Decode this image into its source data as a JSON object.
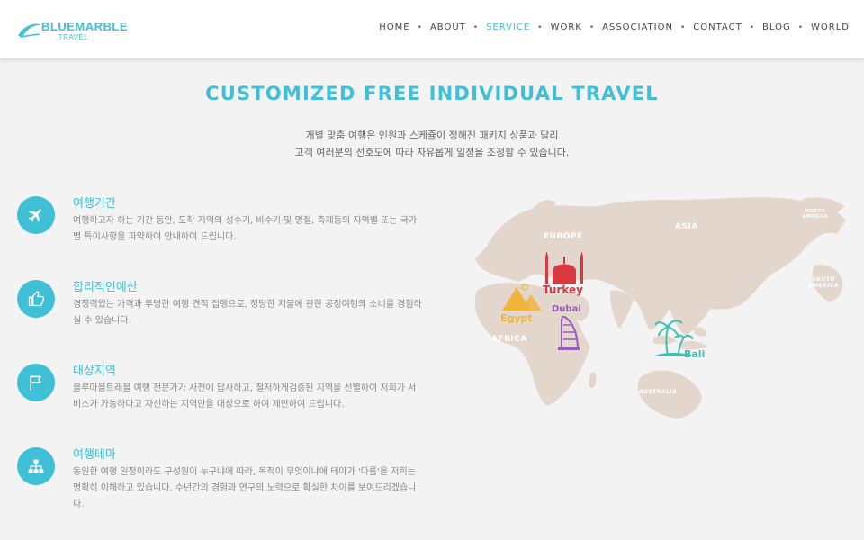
{
  "brand": {
    "name_top": "BLUEMARBLE",
    "name_bottom": ".TRAVEL"
  },
  "nav": {
    "items": [
      "HOME",
      "ABOUT",
      "SERVICE",
      "WORK",
      "ASSOCIATION",
      "CONTACT",
      "BLOG",
      "WORLD"
    ],
    "active": "SERVICE",
    "separator": "•"
  },
  "hero": {
    "title": "CUSTOMIZED FREE INDIVIDUAL TRAVEL",
    "subtitle_line1": "개별 맞춤 여행은 인원과 스케쥴이 정해진 패키지 상품과 달리",
    "subtitle_line2": "고객 여러분의 선호도에 따라 자유롭게 일정을 조정할 수 있습니다."
  },
  "features": [
    {
      "icon": "airplane-icon",
      "title": "여행기간",
      "desc": "여행하고자 하는 기간 동안, 도착 지역의 성수기, 비수기 및 명절, 축제등의 지역별 또는 국가별 특이사항을 파악하여 안내하여 드립니다."
    },
    {
      "icon": "thumbs-up-icon",
      "title": "합리적인예산",
      "desc": "경쟁력있는 가격과 투명한 여행 견적 집행으로, 정당한 지불에 관한 공정여행의 소비를 경험하실 수 있습니다."
    },
    {
      "icon": "flag-icon",
      "title": "대상지역",
      "desc": "블루마블트래블 여행 전문가가 사전에 답사하고, 철저하게검증된 지역을 선별하여 저희가 서비스가 가능하다고 자신하는 지역만을 대상으로 하여 제안하여 드립니다."
    },
    {
      "icon": "sitemap-icon",
      "title": "여행테마",
      "desc": "동일한 여행 일정이라도 구성원이 누구냐에 따라, 목적이 무엇이냐에 테마가 '다름'을 저희는 명확히 이해하고 있습니다. 수년간의 경험과 연구의 노력으로 확실한 차이를 보여드리겠습니다."
    }
  ],
  "map": {
    "regions": [
      "EUROPE",
      "ASIA",
      "AFRICA",
      "AUSTRALIA",
      "NORTH AMERICA",
      "SOUTH AMERICA"
    ],
    "destinations": [
      {
        "name": "Turkey",
        "color": "#d8393f",
        "icon": "mosque-icon"
      },
      {
        "name": "Egypt",
        "color": "#f0b43c",
        "icon": "pyramid-icon"
      },
      {
        "name": "Dubai",
        "color": "#9b59c4",
        "icon": "burj-al-arab-icon"
      },
      {
        "name": "Bali",
        "color": "#3fc0b0",
        "icon": "palm-tree-icon"
      }
    ],
    "land_color": "#e3d6cd"
  },
  "colors": {
    "accent": "#3fc0d6",
    "background": "#f3f3f3",
    "header": "#ffffff"
  }
}
